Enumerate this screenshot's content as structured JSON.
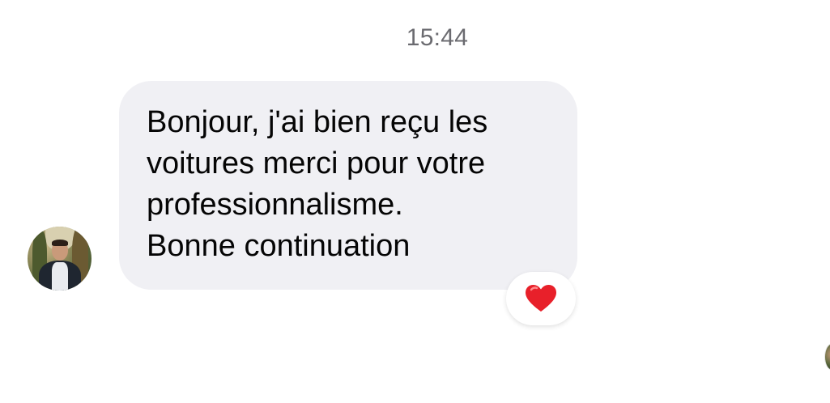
{
  "conversation": {
    "timestamp": "15:44",
    "message": {
      "text": "Bonjour, j'ai bien reçu les\nvoitures merci pour votre\nprofessionnalisme.\nBonne continuation",
      "bubble_color": "#f0f0f4",
      "reaction": {
        "emoji_name": "red-heart-icon",
        "color": "#e8202a"
      }
    },
    "sender_avatar": "avatar",
    "seen_avatar": "seen-indicator-avatar"
  }
}
